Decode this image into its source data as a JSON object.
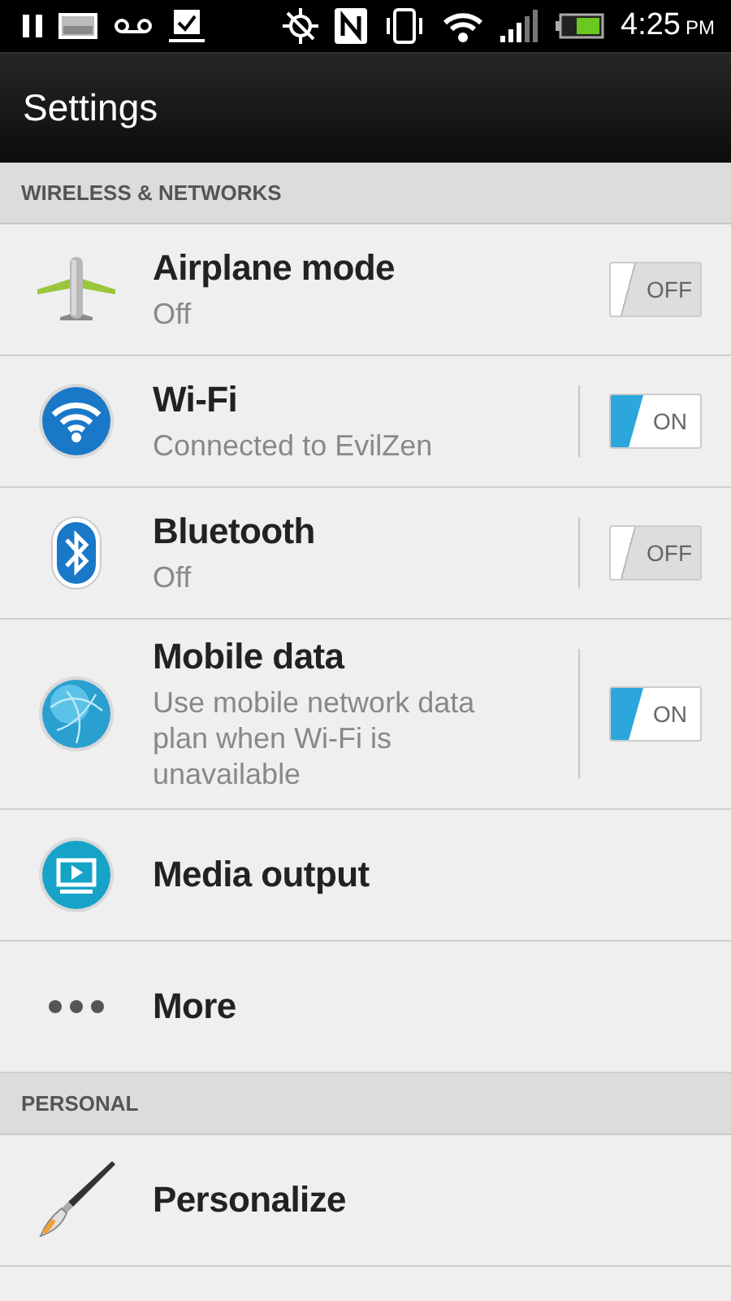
{
  "status_bar": {
    "time": "4:25",
    "meridiem": "PM"
  },
  "action_bar": {
    "title": "Settings"
  },
  "sections": [
    {
      "header": "WIRELESS & NETWORKS",
      "items": [
        {
          "title": "Airplane mode",
          "summary": "Off",
          "kind": "toggle",
          "separator": false,
          "toggle": {
            "on": false,
            "label": "OFF"
          }
        },
        {
          "title": "Wi-Fi",
          "summary": "Connected to EvilZen",
          "kind": "toggle",
          "separator": true,
          "toggle": {
            "on": true,
            "label": "ON"
          }
        },
        {
          "title": "Bluetooth",
          "summary": "Off",
          "kind": "toggle",
          "separator": true,
          "toggle": {
            "on": false,
            "label": "OFF"
          }
        },
        {
          "title": "Mobile data",
          "summary": "Use mobile network data plan when Wi-Fi is unavailable",
          "kind": "toggle",
          "separator": true,
          "toggle": {
            "on": true,
            "label": "ON"
          }
        },
        {
          "title": "Media output",
          "kind": "plain"
        },
        {
          "title": "More",
          "kind": "plain"
        }
      ]
    },
    {
      "header": "PERSONAL",
      "items": [
        {
          "title": "Personalize",
          "kind": "plain"
        }
      ]
    }
  ]
}
